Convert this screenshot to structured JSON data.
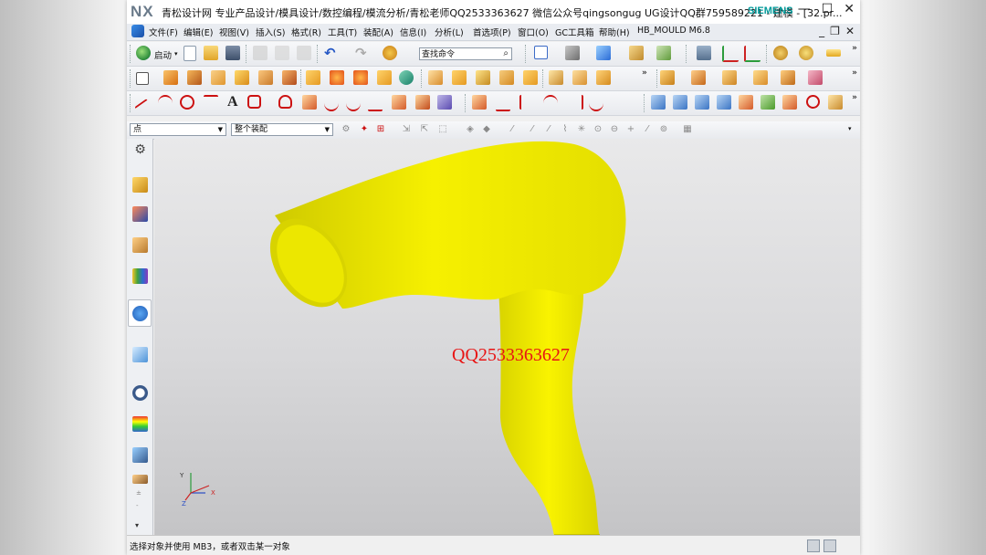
{
  "window": {
    "logo": "NX",
    "title": "青松设计网 专业产品设计/模具设计/数控编程/模流分析/青松老师QQ2533363627 微信公众号qingsongug UG设计QQ群759589221 - 建模 - [32.pr...",
    "brand": "SIEMENS",
    "controls": [
      "—",
      "☐",
      "✕"
    ]
  },
  "menu": {
    "items": [
      "文件(F)",
      "编辑(E)",
      "视图(V)",
      "插入(S)",
      "格式(R)",
      "工具(T)",
      "装配(A)",
      "信息(I)",
      "分析(L)",
      "首选项(P)",
      "窗口(O)",
      "GC工具箱",
      "帮助(H)",
      "HB_MOULD M6.8"
    ],
    "mdi_controls": [
      "_",
      "❐",
      "✕"
    ]
  },
  "toolbar": {
    "start_label": "启动",
    "command_search_placeholder": "查找命令"
  },
  "selection_bar": {
    "type_filter": "点",
    "scope_filter": "整个装配"
  },
  "viewport": {
    "watermark": "QQ2533363627",
    "model_color": "#f3ee00",
    "triad_axes": [
      "X",
      "Y",
      "Z"
    ]
  },
  "status": {
    "prompt": "选择对象并使用 MB3，或者双击某一对象"
  },
  "colors": {
    "brand": "#009999",
    "watermark": "#e81414",
    "model": "#f3ee00"
  }
}
